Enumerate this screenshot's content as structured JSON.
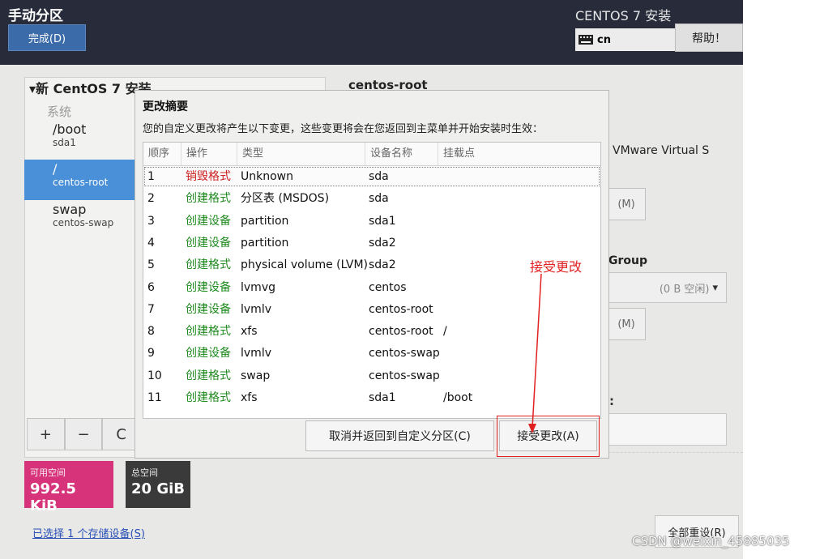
{
  "header": {
    "title": "手动分区",
    "done_button": "完成(D)",
    "installer_title": "CENTOS 7 安装",
    "keyboard_layout": "cn",
    "help_button": "帮助！"
  },
  "left_panel": {
    "install_title": "▾新 CentOS 7 安装",
    "category": "系统",
    "mount_points": [
      {
        "mount": "/boot",
        "device": "sda1"
      },
      {
        "mount": "/",
        "device": "centos-root"
      },
      {
        "mount": "swap",
        "device": "centos-swap"
      }
    ],
    "tools": {
      "add": "+",
      "remove": "−",
      "refresh": "C"
    },
    "available_space": {
      "label": "可用空间",
      "value": "992.5 KiB"
    },
    "total_space": {
      "label": "总空间",
      "value": "20 GiB"
    },
    "storage_link": "已选择 1 个存储设备(S)",
    "reset_button": "全部重设(R)"
  },
  "right_panel": {
    "title": "centos-root",
    "device_desc": "VMware Virtual S",
    "modify_button_1": "(M)",
    "group_label": "Group",
    "group_value": "(0 B 空闲)",
    "modify_button_2": "(M)",
    "colon_label": ":"
  },
  "dialog": {
    "title": "更改摘要",
    "description": "您的自定义更改将产生以下变更，这些变更将会在您返回到主菜单并开始安装时生效：",
    "columns": [
      "顺序",
      "操作",
      "类型",
      "设备名称",
      "挂载点"
    ],
    "rows": [
      {
        "order": "1",
        "action": "销毁格式",
        "type": "Unknown",
        "device": "sda",
        "mount": ""
      },
      {
        "order": "2",
        "action": "创建格式",
        "type": "分区表 (MSDOS)",
        "device": "sda",
        "mount": ""
      },
      {
        "order": "3",
        "action": "创建设备",
        "type": "partition",
        "device": "sda1",
        "mount": ""
      },
      {
        "order": "4",
        "action": "创建设备",
        "type": "partition",
        "device": "sda2",
        "mount": ""
      },
      {
        "order": "5",
        "action": "创建格式",
        "type": "physical volume (LVM)",
        "device": "sda2",
        "mount": ""
      },
      {
        "order": "6",
        "action": "创建设备",
        "type": "lvmvg",
        "device": "centos",
        "mount": ""
      },
      {
        "order": "7",
        "action": "创建设备",
        "type": "lvmlv",
        "device": "centos-root",
        "mount": ""
      },
      {
        "order": "8",
        "action": "创建格式",
        "type": "xfs",
        "device": "centos-root",
        "mount": "/"
      },
      {
        "order": "9",
        "action": "创建设备",
        "type": "lvmlv",
        "device": "centos-swap",
        "mount": ""
      },
      {
        "order": "10",
        "action": "创建格式",
        "type": "swap",
        "device": "centos-swap",
        "mount": ""
      },
      {
        "order": "11",
        "action": "创建格式",
        "type": "xfs",
        "device": "sda1",
        "mount": "/boot"
      }
    ],
    "cancel_button": "取消并返回到自定义分区(C)",
    "accept_button": "接受更改(A)"
  },
  "annotation": {
    "label": "接受更改",
    "color": "#e12020"
  },
  "watermark": "CSDN @weixin_45885035",
  "colors": {
    "header_bg": "#272b3a",
    "selected": "#4a90d9",
    "destroy": "#cc1f1f",
    "create": "#1f8a1f",
    "avail_space": "#d6337a",
    "total_space": "#3a3a3a"
  }
}
